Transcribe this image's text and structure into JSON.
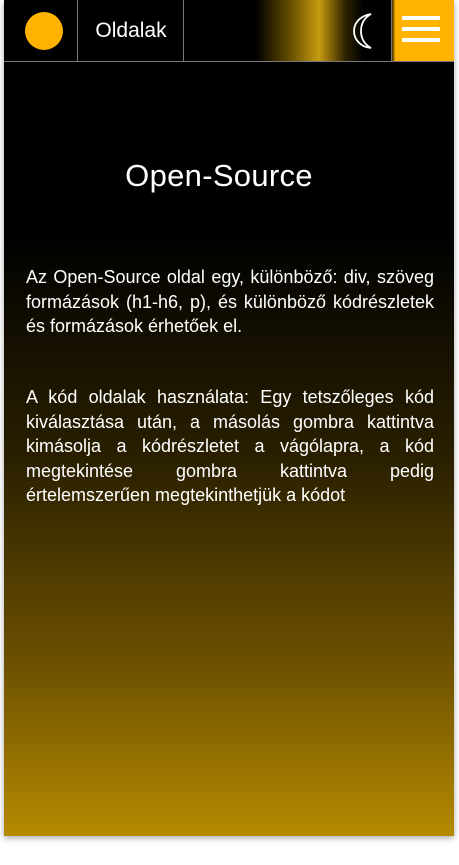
{
  "header": {
    "pages_label": "Oldalak",
    "logo_icon": "circle-logo-icon",
    "theme_icon": "moon-icon",
    "menu_icon": "hamburger-menu-icon",
    "accent_color": "#ffb300"
  },
  "main": {
    "title": "Open-Source",
    "paragraph_1": "Az Open-Source oldal egy, különböző: div, szöveg formázások (h1-h6, p), és különböző kódrészletek és formázások érhetőek el.",
    "paragraph_2": "A kód oldalak használata: Egy tetszőleges kód kiválasztása után, a másolás gombra kattintva kimásolja a kódrészletet a vágólapra, a kód megtekintése gombra kattintva pedig értelemszerűen megtekinthetjük a kódot"
  }
}
